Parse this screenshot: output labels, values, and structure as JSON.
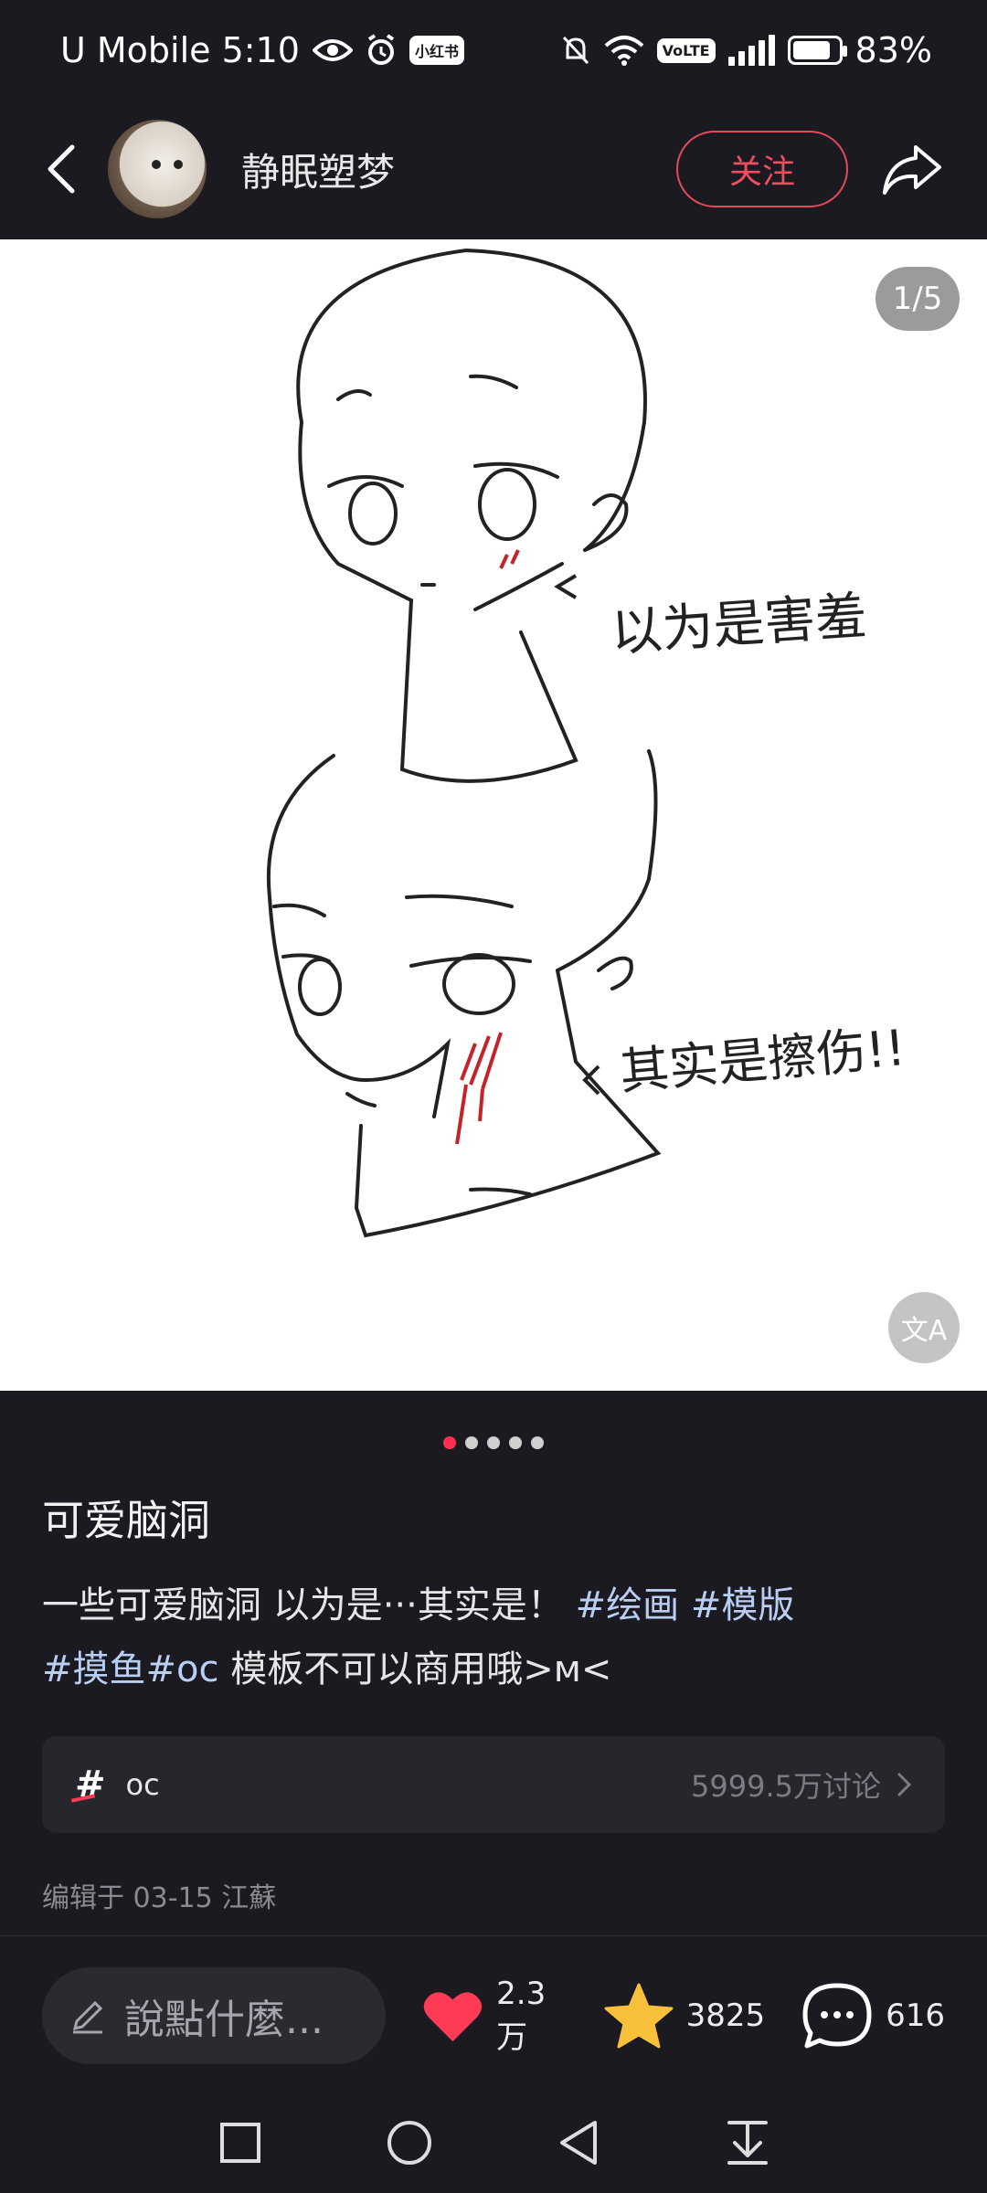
{
  "status_bar": {
    "carrier_time": "U Mobile 5:10",
    "battery_percent": "83%",
    "badge": "小红书",
    "volte": "VoLTE"
  },
  "header": {
    "author_name": "静眠塑梦",
    "follow_label": "关注"
  },
  "image": {
    "page_counter": "1/5",
    "translate_label": "文A",
    "caption_top": "以为是害羞",
    "caption_bottom": "其实是擦伤!!",
    "total_images": 5,
    "current_image": 1
  },
  "note": {
    "title": "可爱脑洞",
    "body_text_1": "一些可爱脑洞  以为是···其实是！",
    "tags_line1": [
      "#绘画",
      "#模版"
    ],
    "tags_line2": [
      "#摸鱼",
      "#oc"
    ],
    "body_text_2": "模板不可以商用哦>м<"
  },
  "topic": {
    "hash": "#",
    "name": "oc",
    "count": "5999.5万讨论"
  },
  "edit_info": "编辑于 03-15 江蘇",
  "bottom_bar": {
    "comment_placeholder": "說點什麼...",
    "likes": "2.3万",
    "collects": "3825",
    "comments": "616"
  },
  "colors": {
    "accent_red": "#ff2f52",
    "follow_red": "#f04d5e",
    "tag_blue": "#b8cef2",
    "star_yellow": "#f9c03c",
    "background": "#1b1a20"
  }
}
